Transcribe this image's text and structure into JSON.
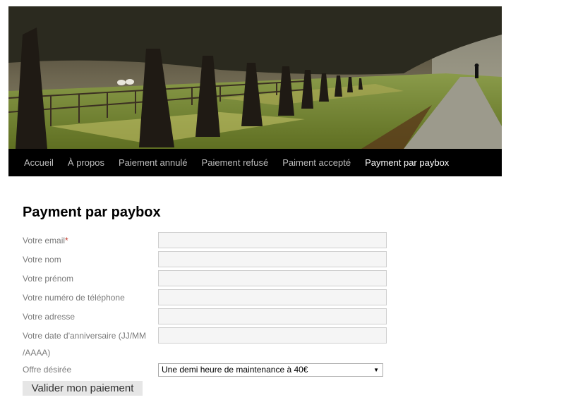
{
  "nav": {
    "items": [
      {
        "label": "Accueil"
      },
      {
        "label": "À propos"
      },
      {
        "label": "Paiement annulé"
      },
      {
        "label": "Paiement refusé"
      },
      {
        "label": "Paiment accepté"
      },
      {
        "label": "Payment par paybox"
      }
    ],
    "active_color": "#ffffff",
    "inactive_color": "#bdbdbd",
    "background": "#000000"
  },
  "page": {
    "title": "Payment par paybox"
  },
  "form": {
    "email_label": "Votre email",
    "email_required_mark": "*",
    "name_label": "Votre nom",
    "firstname_label": "Votre prénom",
    "phone_label": "Votre numéro de téléphone",
    "address_label": "Votre adresse",
    "birthday_label_line1": "Votre date d'anniversaire (JJ/MM",
    "birthday_label_line2": "/AAAA)",
    "offer_label": "Offre désirée",
    "offer_value": "Une demi heure de maintenance à 40€",
    "submit_label": "Valider mon paiement"
  },
  "header_image": {
    "icon": "tree-lined-path-photo"
  }
}
